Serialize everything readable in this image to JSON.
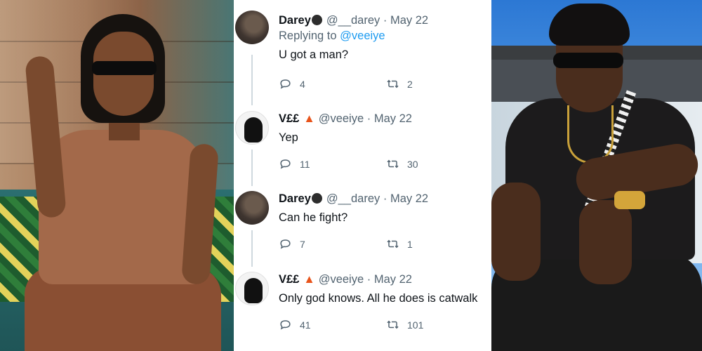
{
  "tweets": [
    {
      "name": "Darey",
      "handle": "@__darey",
      "date": "May 22",
      "replying_prefix": "Replying to",
      "replying_to": "@veeiye",
      "text": "U got a man?",
      "replies": "4",
      "retweets": "2"
    },
    {
      "name": "V££",
      "handle": "@veeiye",
      "date": "May 22",
      "text": "Yep",
      "replies": "11",
      "retweets": "30"
    },
    {
      "name": "Darey",
      "handle": "@__darey",
      "date": "May 22",
      "text": "Can he fight?",
      "replies": "7",
      "retweets": "1"
    },
    {
      "name": "V££",
      "handle": "@veeiye",
      "date": "May 22",
      "text": "Only god knows. All he does is catwalk",
      "replies": "41",
      "retweets": "101"
    }
  ],
  "separator": "·",
  "icons": {
    "reply": "reply-icon",
    "retweet": "retweet-icon",
    "fire": "fire-emoji",
    "sticker": "sticker-emoji"
  },
  "colors": {
    "link": "#1d9bf0",
    "muted": "#536471",
    "text": "#0f1419",
    "thread_line": "#cfd9de"
  }
}
